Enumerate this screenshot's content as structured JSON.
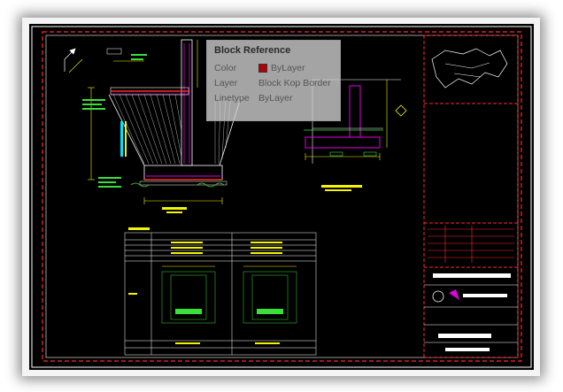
{
  "block_reference": {
    "title": "Block Reference",
    "properties": [
      {
        "key": "Color",
        "value": "ByLayer",
        "swatch": "#b40000"
      },
      {
        "key": "Layer",
        "value": "Block Kop Border"
      },
      {
        "key": "Linetype",
        "value": "ByLayer"
      }
    ]
  },
  "colors": {
    "background": "#000000",
    "border_dash": "#ff2a2a",
    "outline_white": "#ffffff",
    "geometry_yellow": "#f4f400",
    "geometry_green": "#39e03a",
    "geometry_magenta": "#e000e0",
    "geometry_cyan": "#00e0ff",
    "geometry_red": "#ff2a2a"
  }
}
